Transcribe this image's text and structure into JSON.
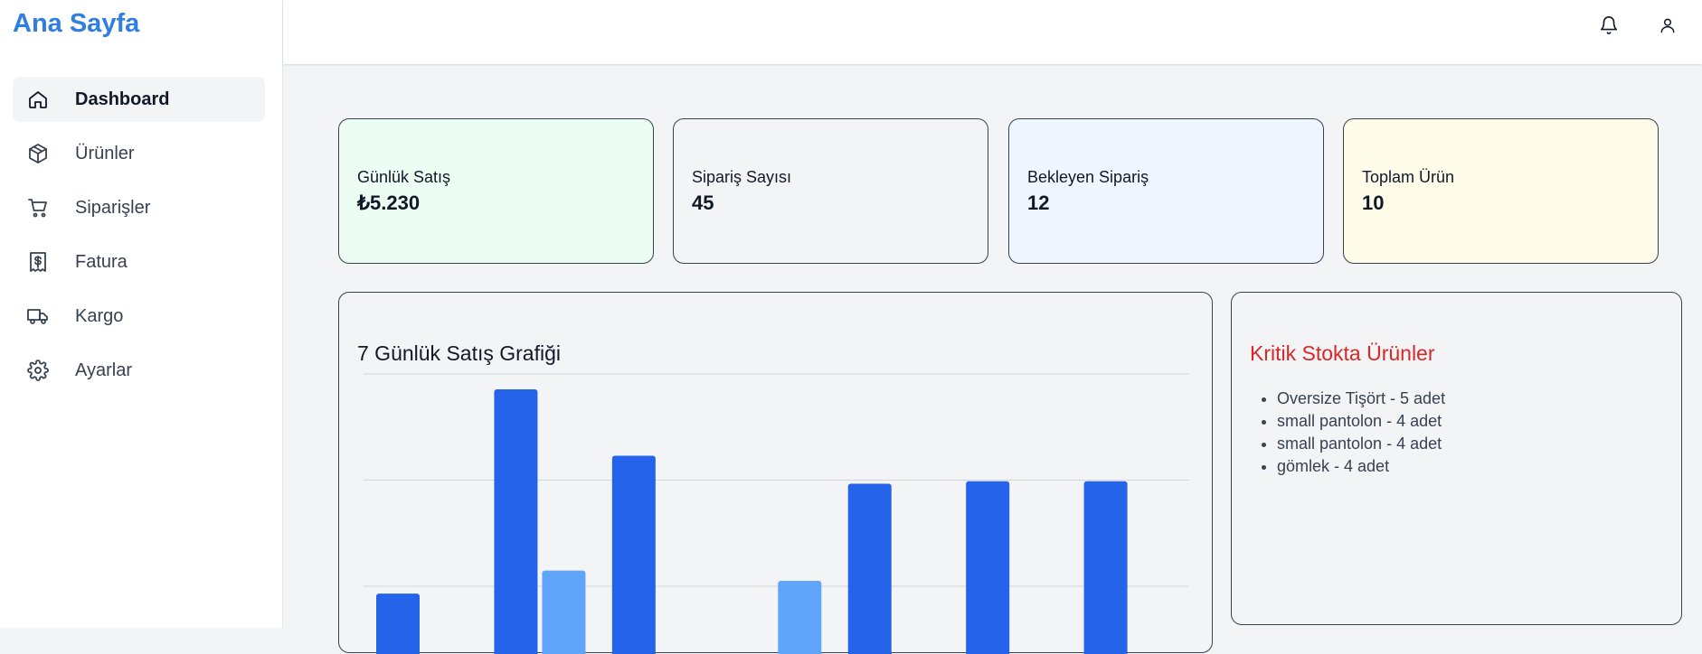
{
  "brand": "Ana Sayfa",
  "sidebar": {
    "items": [
      {
        "label": "Dashboard",
        "icon": "home-icon",
        "active": true
      },
      {
        "label": "Ürünler",
        "icon": "package-icon",
        "active": false
      },
      {
        "label": "Siparişler",
        "icon": "cart-icon",
        "active": false
      },
      {
        "label": "Fatura",
        "icon": "receipt-icon",
        "active": false
      },
      {
        "label": "Kargo",
        "icon": "truck-icon",
        "active": false
      },
      {
        "label": "Ayarlar",
        "icon": "gear-icon",
        "active": false
      }
    ]
  },
  "header": {
    "icons": [
      "bell-icon",
      "user-icon"
    ]
  },
  "stats": [
    {
      "label": "Günlük Satış",
      "value": "₺5.230",
      "bg": "#ecfdf3"
    },
    {
      "label": "Sipariş Sayısı",
      "value": "45",
      "bg": "#f3f4f6"
    },
    {
      "label": "Bekleyen Sipariş",
      "value": "12",
      "bg": "#eff6ff"
    },
    {
      "label": "Toplam Ürün",
      "value": "10",
      "bg": "#fefce8"
    }
  ],
  "sales_panel": {
    "title": "7 Günlük Satış Grafiği"
  },
  "critical_panel": {
    "title": "Kritik Stokta Ürünler",
    "title_color": "#dc2626",
    "items": [
      "Oversize Tişört - 5 adet",
      "small pantolon - 4 adet",
      "small pantolon - 4 adet",
      "gömlek - 4 adet"
    ]
  },
  "chart_data": {
    "type": "bar",
    "title": "7 Günlük Satış Grafiği",
    "categories": [
      "",
      "",
      "",
      "",
      "",
      "",
      ""
    ],
    "series": [
      {
        "values": [
          3.5,
          11.5,
          8.9,
          0,
          7.8,
          7.9,
          7.9
        ],
        "color": "#2563eb"
      },
      {
        "values": [
          0,
          4.4,
          0,
          4.0,
          0,
          0.35,
          0.35
        ],
        "color": "#60a5fa"
      },
      {
        "values": [
          0,
          0,
          0,
          0,
          0.05,
          0,
          0
        ],
        "color": "#93c5fd"
      }
    ],
    "grid": true,
    "ylim_visible": [
      0,
      12.1
    ]
  }
}
